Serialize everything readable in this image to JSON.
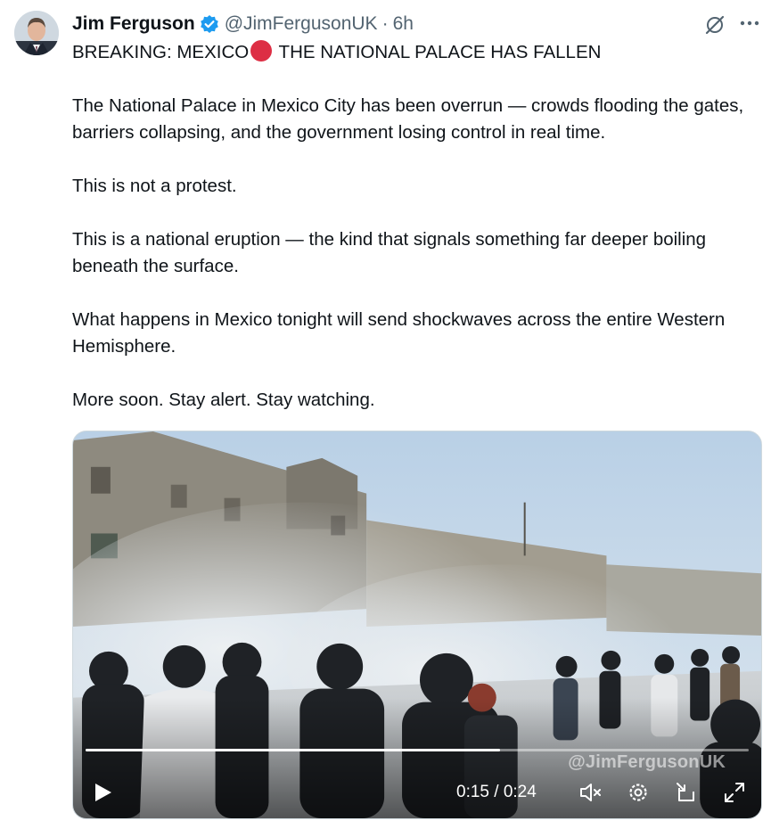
{
  "tweet": {
    "author_name": "Jim Ferguson",
    "handle": "@JimFergusonUK",
    "separator": "·",
    "time": "6h",
    "headline_pre": "BREAKING: MEXICO",
    "headline_post": " THE NATIONAL PALACE HAS FALLEN",
    "paragraphs": [
      "The National Palace in Mexico City has been overrun — crowds flooding the gates, barriers collapsing, and the government losing control in real time.",
      "This is not a protest.",
      "This is a national eruption — the kind that signals something far deeper boiling beneath the surface.",
      "What happens in Mexico tonight will send shockwaves across the entire Western Hemisphere.",
      "More soon. Stay alert. Stay watching."
    ]
  },
  "video": {
    "watermark": "@JimFergusonUK",
    "timecode": "0:15 / 0:24",
    "progress": 0.625
  },
  "icons": {
    "verified": "verified-badge-icon",
    "grok": "grok-icon",
    "more": "more-icon",
    "play": "play-icon",
    "mute": "muted-speaker-icon",
    "settings": "gear-icon",
    "pip": "picture-in-picture-icon",
    "fullscreen": "fullscreen-icon"
  },
  "colors": {
    "text": "#0f1419",
    "secondary": "#536471",
    "verified": "#1d9bf0",
    "red_circle": "#dd2e44"
  }
}
